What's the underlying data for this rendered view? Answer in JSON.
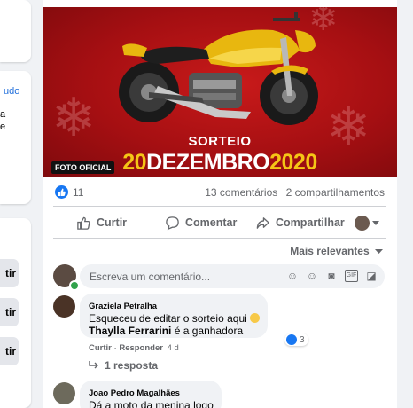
{
  "left_column": {
    "link_text": "udo",
    "fragments": [
      "a",
      "e"
    ],
    "buttons": [
      "tir",
      "tir",
      "tir"
    ]
  },
  "post": {
    "image": {
      "sorteio": "SORTEIO",
      "date_part1": "20",
      "date_part2": "DEZEMBRO",
      "date_part3": "2020",
      "badge": "FOTO OFICIAL"
    },
    "reactions_count": "11",
    "comments_count": "13 comentários",
    "shares_count": "2 compartilhamentos",
    "actions": {
      "like": "Curtir",
      "comment": "Comentar",
      "share": "Compartilhar"
    },
    "sort_label": "Mais relevantes",
    "composer_placeholder": "Escreva um comentário...",
    "comments": [
      {
        "author": "Graziela Petralha",
        "line1": "Esqueceu de editar o sorteio aqui",
        "line2_bold": "Thaylla Ferrarini",
        "line2_rest": " é a ganhadora",
        "like_action": "Curtir",
        "separator": "·",
        "reply_action": "Responder",
        "time": "4 d",
        "reaction_count": "3",
        "replies": "1 resposta"
      },
      {
        "author": "Joao Pedro Magalhães",
        "line1": "Dá a moto da menina logo"
      }
    ]
  },
  "colors": {
    "accent": "#1877f2",
    "banner_red": "#a50f12",
    "date_yellow": "#f5c516"
  }
}
